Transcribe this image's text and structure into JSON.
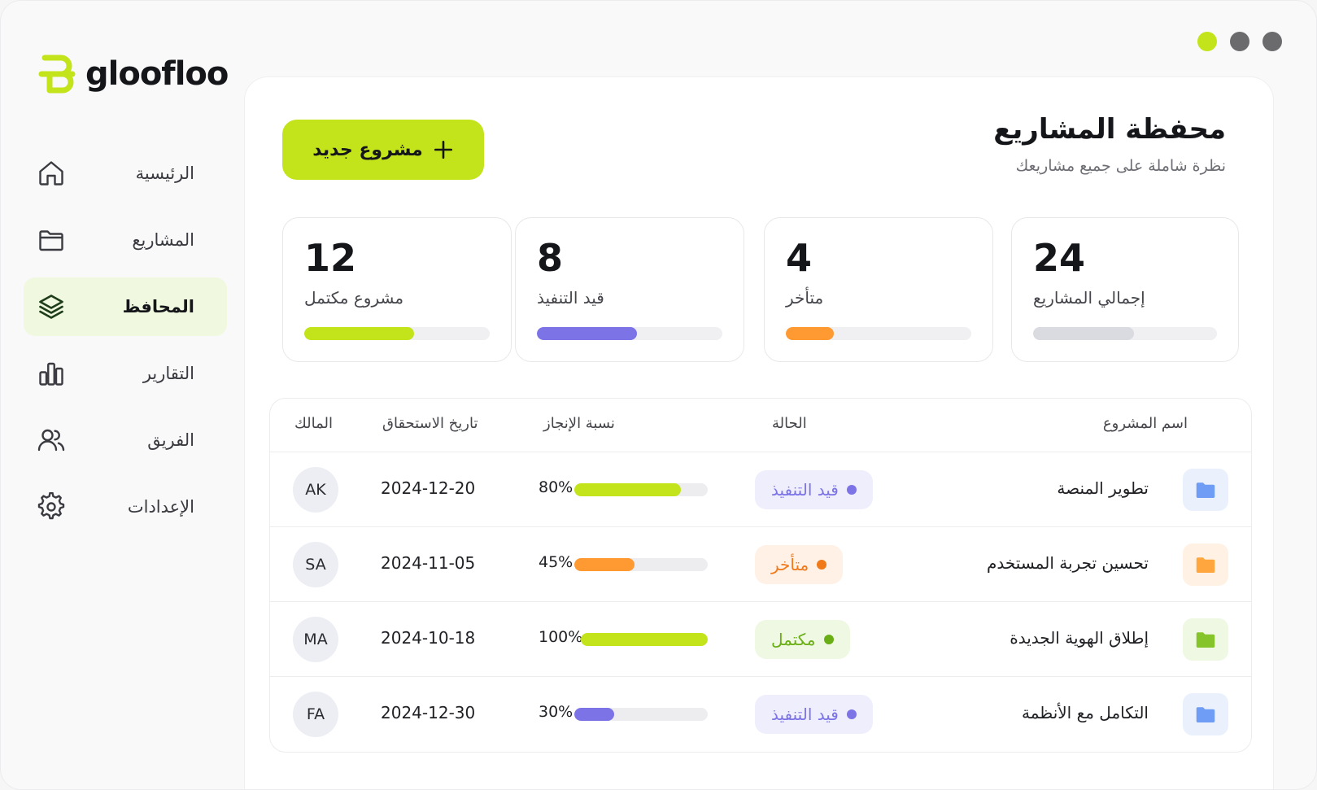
{
  "app": {
    "brand": "gloofloo",
    "accent": "#c3e41b"
  },
  "sidebar": {
    "items": [
      {
        "label": "الرئيسية",
        "icon": "home-icon",
        "active": false
      },
      {
        "label": "المشاريع",
        "icon": "folder-icon",
        "active": false
      },
      {
        "label": "المحافظ",
        "icon": "layers-icon",
        "active": true
      },
      {
        "label": "التقارير",
        "icon": "bar-chart-icon",
        "active": false
      },
      {
        "label": "الفريق",
        "icon": "users-icon",
        "active": false
      },
      {
        "label": "الإعدادات",
        "icon": "gear-icon",
        "active": false
      }
    ]
  },
  "header": {
    "title": "محفظة المشاريع",
    "subtitle": "نظرة شاملة على جميع مشاريعك",
    "new_button_label": "مشروع جديد"
  },
  "stats": [
    {
      "value": "24",
      "label": "إجمالي المشاريع",
      "progress": 0.55,
      "color": "#dadbe0"
    },
    {
      "value": "4",
      "label": "متأخر",
      "progress": 0.26,
      "color": "#ff9a33"
    },
    {
      "value": "8",
      "label": "قيد التنفيذ",
      "progress": 0.54,
      "color": "#7b73e6"
    },
    {
      "value": "12",
      "label": "مشروع مكتمل",
      "progress": 0.59,
      "color": "#c3e41b"
    }
  ],
  "table": {
    "columns": {
      "name": "اسم المشروع",
      "status": "الحالة",
      "progress": "نسبة الإنجاز",
      "due": "تاريخ الاستحقاق",
      "owner": "المالك"
    },
    "rows": [
      {
        "name": "تطوير المنصة",
        "status": "قيد التنفيذ",
        "status_color": "#7b73e6",
        "status_bg": "#eeeefc",
        "progress_label": "80%",
        "progress": 0.8,
        "bar_color": "#c3e41b",
        "due": "2024-12-20",
        "owner": "AK",
        "icon": "folder-icon",
        "icon_color": "#6f9cf4",
        "icon_bg": "#eaf1fd"
      },
      {
        "name": "تحسين تجربة المستخدم",
        "status": "متأخر",
        "status_color": "#f07a1a",
        "status_bg": "#fff1e6",
        "progress_label": "45%",
        "progress": 0.45,
        "bar_color": "#ff9a33",
        "due": "2024-11-05",
        "owner": "SA",
        "icon": "folder-icon",
        "icon_color": "#ffa63e",
        "icon_bg": "#fff1e3"
      },
      {
        "name": "إطلاق الهوية الجديدة",
        "status": "مكتمل",
        "status_color": "#6aae16",
        "status_bg": "#eff8e2",
        "progress_label": "100%",
        "progress": 1.0,
        "bar_color": "#c3e41b",
        "due": "2024-10-18",
        "owner": "MA",
        "icon": "folder-icon",
        "icon_color": "#86c42b",
        "icon_bg": "#eef8e2"
      },
      {
        "name": "التكامل مع الأنظمة",
        "status": "قيد التنفيذ",
        "status_color": "#7b73e6",
        "status_bg": "#eeeefc",
        "progress_label": "30%",
        "progress": 0.3,
        "bar_color": "#7b73e6",
        "due": "2024-12-30",
        "owner": "FA",
        "icon": "folder-icon",
        "icon_color": "#6f9cf4",
        "icon_bg": "#eaf1fd"
      }
    ]
  }
}
